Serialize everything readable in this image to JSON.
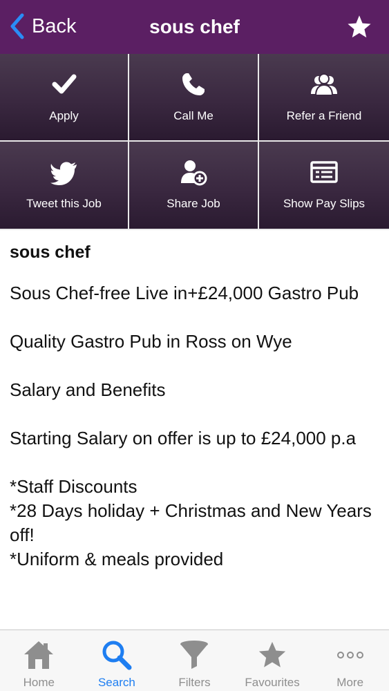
{
  "nav": {
    "back_label": "Back",
    "title": "sous chef",
    "back_icon": "chevron-left-icon",
    "favourite_icon": "star-icon"
  },
  "actions": [
    {
      "label": "Apply",
      "icon": "checkmark-icon"
    },
    {
      "label": "Call Me",
      "icon": "phone-icon"
    },
    {
      "label": "Refer a Friend",
      "icon": "people-icon"
    },
    {
      "label": "Tweet this Job",
      "icon": "twitter-bird-icon"
    },
    {
      "label": "Share Job",
      "icon": "add-person-icon"
    },
    {
      "label": "Show Pay Slips",
      "icon": "payslip-list-icon"
    }
  ],
  "job": {
    "title": "sous chef",
    "paragraphs": [
      "Sous Chef-free Live in+£24,000 Gastro Pub",
      "Quality Gastro Pub in Ross on Wye",
      "Salary and Benefits",
      "Starting Salary on offer is up to £24,000 p.a"
    ],
    "benefits": [
      "*Staff Discounts",
      "*28 Days holiday + Christmas and New Years off!",
      "*Uniform & meals provided"
    ]
  },
  "tabs": [
    {
      "label": "Home",
      "icon": "home-icon",
      "active": false
    },
    {
      "label": "Search",
      "icon": "search-icon",
      "active": true
    },
    {
      "label": "Filters",
      "icon": "filter-funnel-icon",
      "active": false
    },
    {
      "label": "Favourites",
      "icon": "star-icon",
      "active": false
    },
    {
      "label": "More",
      "icon": "more-dots-icon",
      "active": false
    }
  ],
  "colors": {
    "nav_background": "#5b1f63",
    "tile_background": "#3a2840",
    "accent": "#1e7ef1",
    "back_arrow": "#2a8cf6",
    "inactive_tab": "#8e8e8e"
  }
}
